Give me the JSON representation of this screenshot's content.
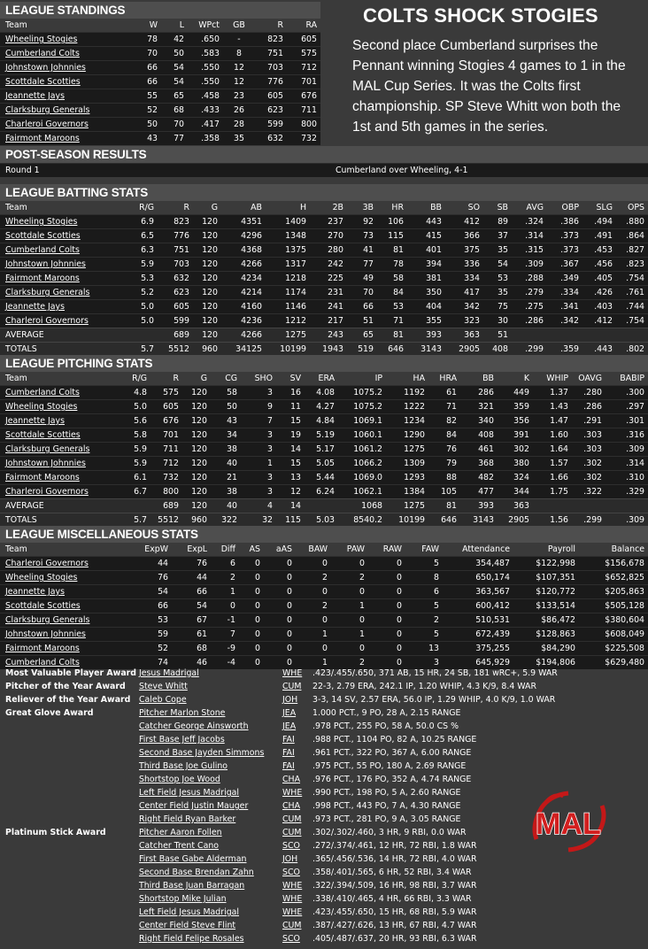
{
  "headline": "COLTS SHOCK STOGIES",
  "story": "Second place Cumberland surprises the Pennant winning Stogies 4 games to 1 in the MAL Cup Series. It was the Colts first championship. SP Steve Whitt won both the 1st and 5th games in the series.",
  "logo_text": "MAL",
  "standings": {
    "title": "LEAGUE STANDINGS",
    "columns": [
      "Team",
      "W",
      "L",
      "WPct",
      "GB",
      "R",
      "RA"
    ],
    "rows": [
      [
        "Wheeling Stogies",
        "78",
        "42",
        ".650",
        "-",
        "823",
        "605"
      ],
      [
        "Cumberland Colts",
        "70",
        "50",
        ".583",
        "8",
        "751",
        "575"
      ],
      [
        "Johnstown Johnnies",
        "66",
        "54",
        ".550",
        "12",
        "703",
        "712"
      ],
      [
        "Scottdale Scotties",
        "66",
        "54",
        ".550",
        "12",
        "776",
        "701"
      ],
      [
        "Jeannette Jays",
        "55",
        "65",
        ".458",
        "23",
        "605",
        "676"
      ],
      [
        "Clarksburg Generals",
        "52",
        "68",
        ".433",
        "26",
        "623",
        "711"
      ],
      [
        "Charleroi Governors",
        "50",
        "70",
        ".417",
        "28",
        "599",
        "800"
      ],
      [
        "Fairmont Maroons",
        "43",
        "77",
        ".358",
        "35",
        "632",
        "732"
      ]
    ]
  },
  "postseason": {
    "title": "POST-SEASON RESULTS",
    "round": "Round 1",
    "result": "Cumberland over Wheeling, 4-1"
  },
  "batting": {
    "title": "LEAGUE BATTING STATS",
    "columns": [
      "Team",
      "R/G",
      "R",
      "G",
      "AB",
      "H",
      "2B",
      "3B",
      "HR",
      "BB",
      "SO",
      "SB",
      "AVG",
      "OBP",
      "SLG",
      "OPS"
    ],
    "rows": [
      [
        "Wheeling Stogies",
        "6.9",
        "823",
        "120",
        "4351",
        "1409",
        "237",
        "92",
        "106",
        "443",
        "412",
        "89",
        ".324",
        ".386",
        ".494",
        ".880"
      ],
      [
        "Scottdale Scotties",
        "6.5",
        "776",
        "120",
        "4296",
        "1348",
        "270",
        "73",
        "115",
        "415",
        "366",
        "37",
        ".314",
        ".373",
        ".491",
        ".864"
      ],
      [
        "Cumberland Colts",
        "6.3",
        "751",
        "120",
        "4368",
        "1375",
        "280",
        "41",
        "81",
        "401",
        "375",
        "35",
        ".315",
        ".373",
        ".453",
        ".827"
      ],
      [
        "Johnstown Johnnies",
        "5.9",
        "703",
        "120",
        "4266",
        "1317",
        "242",
        "77",
        "78",
        "394",
        "336",
        "54",
        ".309",
        ".367",
        ".456",
        ".823"
      ],
      [
        "Fairmont Maroons",
        "5.3",
        "632",
        "120",
        "4234",
        "1218",
        "225",
        "49",
        "58",
        "381",
        "334",
        "53",
        ".288",
        ".349",
        ".405",
        ".754"
      ],
      [
        "Clarksburg Generals",
        "5.2",
        "623",
        "120",
        "4214",
        "1174",
        "231",
        "70",
        "84",
        "350",
        "417",
        "35",
        ".279",
        ".334",
        ".426",
        ".761"
      ],
      [
        "Jeannette Jays",
        "5.0",
        "605",
        "120",
        "4160",
        "1146",
        "241",
        "66",
        "53",
        "404",
        "342",
        "75",
        ".275",
        ".341",
        ".403",
        ".744"
      ],
      [
        "Charleroi Governors",
        "5.0",
        "599",
        "120",
        "4236",
        "1212",
        "217",
        "51",
        "71",
        "355",
        "323",
        "30",
        ".286",
        ".342",
        ".412",
        ".754"
      ]
    ],
    "average": [
      "AVERAGE",
      "",
      "689",
      "120",
      "4266",
      "1275",
      "243",
      "65",
      "81",
      "393",
      "363",
      "51",
      "",
      "",
      "",
      ""
    ],
    "totals": [
      "TOTALS",
      "5.7",
      "5512",
      "960",
      "34125",
      "10199",
      "1943",
      "519",
      "646",
      "3143",
      "2905",
      "408",
      ".299",
      ".359",
      ".443",
      ".802"
    ]
  },
  "pitching": {
    "title": "LEAGUE PITCHING STATS",
    "columns": [
      "Team",
      "R/G",
      "R",
      "G",
      "CG",
      "SHO",
      "SV",
      "ERA",
      "IP",
      "HA",
      "HRA",
      "BB",
      "K",
      "WHIP",
      "OAVG",
      "BABIP"
    ],
    "rows": [
      [
        "Cumberland Colts",
        "4.8",
        "575",
        "120",
        "58",
        "3",
        "16",
        "4.08",
        "1075.2",
        "1192",
        "61",
        "286",
        "449",
        "1.37",
        ".280",
        ".300"
      ],
      [
        "Wheeling Stogies",
        "5.0",
        "605",
        "120",
        "50",
        "9",
        "11",
        "4.27",
        "1075.2",
        "1222",
        "71",
        "321",
        "359",
        "1.43",
        ".286",
        ".297"
      ],
      [
        "Jeannette Jays",
        "5.6",
        "676",
        "120",
        "43",
        "7",
        "15",
        "4.84",
        "1069.1",
        "1234",
        "82",
        "340",
        "356",
        "1.47",
        ".291",
        ".301"
      ],
      [
        "Scottdale Scotties",
        "5.8",
        "701",
        "120",
        "34",
        "3",
        "19",
        "5.19",
        "1060.1",
        "1290",
        "84",
        "408",
        "391",
        "1.60",
        ".303",
        ".316"
      ],
      [
        "Clarksburg Generals",
        "5.9",
        "711",
        "120",
        "38",
        "3",
        "14",
        "5.17",
        "1061.2",
        "1275",
        "76",
        "461",
        "302",
        "1.64",
        ".303",
        ".309"
      ],
      [
        "Johnstown Johnnies",
        "5.9",
        "712",
        "120",
        "40",
        "1",
        "15",
        "5.05",
        "1066.2",
        "1309",
        "79",
        "368",
        "380",
        "1.57",
        ".302",
        ".314"
      ],
      [
        "Fairmont Maroons",
        "6.1",
        "732",
        "120",
        "21",
        "3",
        "13",
        "5.44",
        "1069.0",
        "1293",
        "88",
        "482",
        "324",
        "1.66",
        ".302",
        ".310"
      ],
      [
        "Charleroi Governors",
        "6.7",
        "800",
        "120",
        "38",
        "3",
        "12",
        "6.24",
        "1062.1",
        "1384",
        "105",
        "477",
        "344",
        "1.75",
        ".322",
        ".329"
      ]
    ],
    "average": [
      "AVERAGE",
      "",
      "689",
      "120",
      "40",
      "4",
      "14",
      "",
      "1068",
      "1275",
      "81",
      "393",
      "363",
      "",
      "",
      ""
    ],
    "totals": [
      "TOTALS",
      "5.7",
      "5512",
      "960",
      "322",
      "32",
      "115",
      "5.03",
      "8540.2",
      "10199",
      "646",
      "3143",
      "2905",
      "1.56",
      ".299",
      ".309"
    ]
  },
  "misc": {
    "title": "LEAGUE MISCELLANEOUS STATS",
    "columns": [
      "Team",
      "ExpW",
      "ExpL",
      "Diff",
      "AS",
      "aAS",
      "BAW",
      "PAW",
      "RAW",
      "FAW",
      "Attendance",
      "Payroll",
      "Balance"
    ],
    "rows": [
      [
        "Charleroi Governors",
        "44",
        "76",
        "6",
        "0",
        "0",
        "0",
        "0",
        "0",
        "5",
        "354,487",
        "$122,998",
        "$156,678"
      ],
      [
        "Wheeling Stogies",
        "76",
        "44",
        "2",
        "0",
        "0",
        "2",
        "2",
        "0",
        "8",
        "650,174",
        "$107,351",
        "$652,825"
      ],
      [
        "Jeannette Jays",
        "54",
        "66",
        "1",
        "0",
        "0",
        "0",
        "0",
        "0",
        "6",
        "363,567",
        "$120,772",
        "$205,863"
      ],
      [
        "Scottdale Scotties",
        "66",
        "54",
        "0",
        "0",
        "0",
        "2",
        "1",
        "0",
        "5",
        "600,412",
        "$133,514",
        "$505,128"
      ],
      [
        "Clarksburg Generals",
        "53",
        "67",
        "-1",
        "0",
        "0",
        "0",
        "0",
        "0",
        "2",
        "510,531",
        "$86,472",
        "$380,604"
      ],
      [
        "Johnstown Johnnies",
        "59",
        "61",
        "7",
        "0",
        "0",
        "1",
        "1",
        "0",
        "5",
        "672,439",
        "$128,863",
        "$608,049"
      ],
      [
        "Fairmont Maroons",
        "52",
        "68",
        "-9",
        "0",
        "0",
        "0",
        "0",
        "0",
        "13",
        "375,255",
        "$84,290",
        "$225,508"
      ],
      [
        "Cumberland Colts",
        "74",
        "46",
        "-4",
        "0",
        "0",
        "1",
        "2",
        "0",
        "3",
        "645,929",
        "$194,806",
        "$629,480"
      ]
    ]
  },
  "awards": [
    {
      "award": "Most Valuable Player Award",
      "player": "Jesus Madrigal",
      "team": "WHE",
      "stats": ".423/.455/.650, 371 AB, 15 HR, 24 SB, 181 wRC+, 5.9 WAR"
    },
    {
      "award": "Pitcher of the Year Award",
      "player": "Steve Whitt",
      "team": "CUM",
      "stats": "22-3, 2.79 ERA, 242.1 IP, 1.20 WHIP, 4.3 K/9, 8.4 WAR"
    },
    {
      "award": "Reliever of the Year Award",
      "player": "Caleb Cope",
      "team": "JOH",
      "stats": "3-3, 14 SV, 2.57 ERA, 56.0 IP, 1.29 WHIP, 4.0 K/9, 1.0 WAR"
    },
    {
      "award": "Great Glove Award",
      "player": "Pitcher Marlon Stone",
      "team": "JEA",
      "stats": "1.000 PCT., 9 PO, 28 A, 2.15 RANGE"
    },
    {
      "award": "",
      "player": "Catcher George Ainsworth",
      "team": "JEA",
      "stats": ".978 PCT., 255 PO, 58 A, 50.0 CS %"
    },
    {
      "award": "",
      "player": "First Base Jeff Jacobs",
      "team": "FAI",
      "stats": ".988 PCT., 1104 PO, 82 A, 10.25 RANGE"
    },
    {
      "award": "",
      "player": "Second Base Jayden Simmons",
      "team": "FAI",
      "stats": ".961 PCT., 322 PO, 367 A, 6.00 RANGE"
    },
    {
      "award": "",
      "player": "Third Base Joe Gulino",
      "team": "FAI",
      "stats": ".975 PCT., 55 PO, 180 A, 2.69 RANGE"
    },
    {
      "award": "",
      "player": "Shortstop Joe Wood",
      "team": "CHA",
      "stats": ".976 PCT., 176 PO, 352 A, 4.74 RANGE"
    },
    {
      "award": "",
      "player": "Left Field Jesus Madrigal",
      "team": "WHE",
      "stats": ".990 PCT., 198 PO, 5 A, 2.60 RANGE"
    },
    {
      "award": "",
      "player": "Center Field Justin Mauger",
      "team": "CHA",
      "stats": ".998 PCT., 443 PO, 7 A, 4.30 RANGE"
    },
    {
      "award": "",
      "player": "Right Field Ryan Barker",
      "team": "CUM",
      "stats": ".973 PCT., 281 PO, 9 A, 3.05 RANGE"
    },
    {
      "award": "Platinum Stick Award",
      "player": "Pitcher Aaron Follen",
      "team": "CUM",
      "stats": ".302/.302/.460, 3 HR, 9 RBI, 0.0 WAR"
    },
    {
      "award": "",
      "player": "Catcher Trent Cano",
      "team": "SCO",
      "stats": ".272/.374/.461, 12 HR, 72 RBI, 1.8 WAR"
    },
    {
      "award": "",
      "player": "First Base Gabe Alderman",
      "team": "JOH",
      "stats": ".365/.456/.536, 14 HR, 72 RBI, 4.0 WAR"
    },
    {
      "award": "",
      "player": "Second Base Brendan Zahn",
      "team": "SCO",
      "stats": ".358/.401/.565, 6 HR, 52 RBI, 3.4 WAR"
    },
    {
      "award": "",
      "player": "Third Base Juan Barragan",
      "team": "WHE",
      "stats": ".322/.394/.509, 16 HR, 98 RBI, 3.7 WAR"
    },
    {
      "award": "",
      "player": "Shortstop Mike Julian",
      "team": "WHE",
      "stats": ".338/.410/.465, 4 HR, 66 RBI, 3.3 WAR"
    },
    {
      "award": "",
      "player": "Left Field Jesus Madrigal",
      "team": "WHE",
      "stats": ".423/.455/.650, 15 HR, 68 RBI, 5.9 WAR"
    },
    {
      "award": "",
      "player": "Center Field Steve Flint",
      "team": "CUM",
      "stats": ".387/.427/.626, 13 HR, 67 RBI, 4.7 WAR"
    },
    {
      "award": "",
      "player": "Right Field Felipe Rosales",
      "team": "SCO",
      "stats": ".405/.487/.637, 20 HR, 93 RBI, 6.3 WAR"
    }
  ]
}
